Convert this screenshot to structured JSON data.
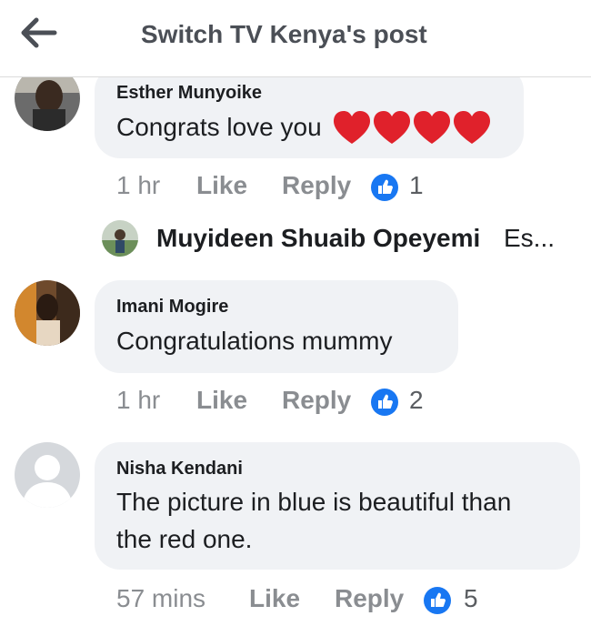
{
  "header": {
    "title": "Switch TV Kenya's post",
    "back_icon": "arrow-left-icon"
  },
  "colors": {
    "like_blue": "#1877f2",
    "heart_red": "#e0212b",
    "bubble_bg": "#f0f2f5",
    "meta_gray": "#8a8d91"
  },
  "comments": [
    {
      "author": "Esther Munyoike",
      "text": "Congrats love you",
      "emoji": "heart x4",
      "time": "1 hr",
      "like_label": "Like",
      "reply_label": "Reply",
      "reaction_count": "1",
      "reply_preview": {
        "name": "Muyideen Shuaib Opeyemi",
        "text": "Es..."
      }
    },
    {
      "author": "Imani Mogire",
      "text": "Congratulations mummy",
      "time": "1 hr",
      "like_label": "Like",
      "reply_label": "Reply",
      "reaction_count": "2"
    },
    {
      "author": "Nisha Kendani",
      "text_line1": "The picture in blue is beautiful than",
      "text_line2": "the red one.",
      "time": "57 mins",
      "like_label": "Like",
      "reply_label": "Reply",
      "reaction_count": "5"
    }
  ]
}
